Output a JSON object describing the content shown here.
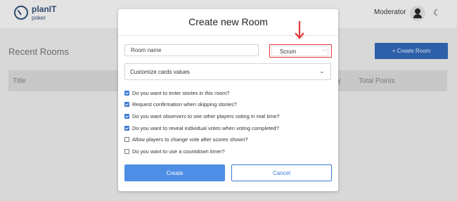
{
  "app": {
    "logo_text": "planIT",
    "logo_sub": "poker",
    "role": "Moderator",
    "page_title": "Recent Rooms",
    "create_room_button": "+ Create Room",
    "table_headers": {
      "title": "Title",
      "partial": "y",
      "points": "Total Points"
    }
  },
  "modal": {
    "title": "Create new Room",
    "room_name_placeholder": "Room name",
    "room_type": "Scrum",
    "cards_label": "Customize cards values",
    "options": [
      {
        "label": "Do you want to enter stories in this room?",
        "checked": true
      },
      {
        "label": "Request confirmation when skipping stories?",
        "checked": true
      },
      {
        "label": "Do you want observers to see other players voting in real time?",
        "checked": true
      },
      {
        "label": "Do you want to reveal individual votes when voting completed?",
        "checked": true
      },
      {
        "label": "Allow players to change vote after scores shown?",
        "checked": false
      },
      {
        "label": "Do you want to use a countdown timer?",
        "checked": false
      }
    ],
    "create_label": "Create",
    "cancel_label": "Cancel"
  },
  "colors": {
    "primary": "#4e8ee6",
    "highlight": "#e5383b",
    "dark_button": "#2c5fa7"
  }
}
